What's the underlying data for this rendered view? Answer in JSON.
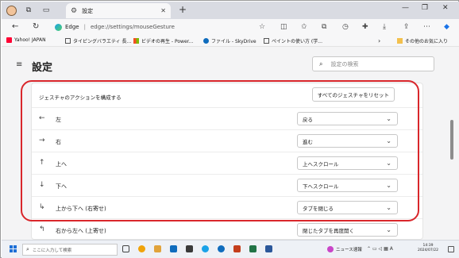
{
  "browser": {
    "tab_title": "設定",
    "url_site": "Edge",
    "url_path": "edge://settings/mouseGesture"
  },
  "favorites": [
    {
      "label": "Yahoo! JAPAN"
    },
    {
      "label": "タイピングバラエティ 長..."
    },
    {
      "label": "ビデオの再生 - Power..."
    },
    {
      "label": "ファイル - SkyDrive"
    },
    {
      "label": "ペイントの使い方 (学..."
    },
    {
      "label": "その他のお気に入り"
    }
  ],
  "settings": {
    "title": "設定",
    "search_placeholder": "設定の検索"
  },
  "gestures": {
    "section_label": "ジェスチャのアクションを構成する",
    "reset_label": "すべてのジェスチャをリセット",
    "rows": [
      {
        "arrow": "←",
        "name": "左",
        "action": "戻る"
      },
      {
        "arrow": "→",
        "name": "右",
        "action": "進む"
      },
      {
        "arrow": "↑",
        "name": "上へ",
        "action": "上へスクロール"
      },
      {
        "arrow": "↓",
        "name": "下へ",
        "action": "下へスクロール"
      },
      {
        "arrow": "↳",
        "name": "上から下へ (右寄せ)",
        "action": "タブを閉じる"
      },
      {
        "arrow": "↰",
        "name": "右から左へ (上寄せ)",
        "action": "閉じたタブを再度開く"
      }
    ]
  },
  "taskbar": {
    "search_placeholder": "ここに入力して検索",
    "news_label": "ニュース速報",
    "ime_label": "A",
    "time": "14:39",
    "date": "2024/07/22"
  },
  "colors": {
    "highlight_outline": "#d9262b",
    "page_bg": "#f4f4f5"
  }
}
